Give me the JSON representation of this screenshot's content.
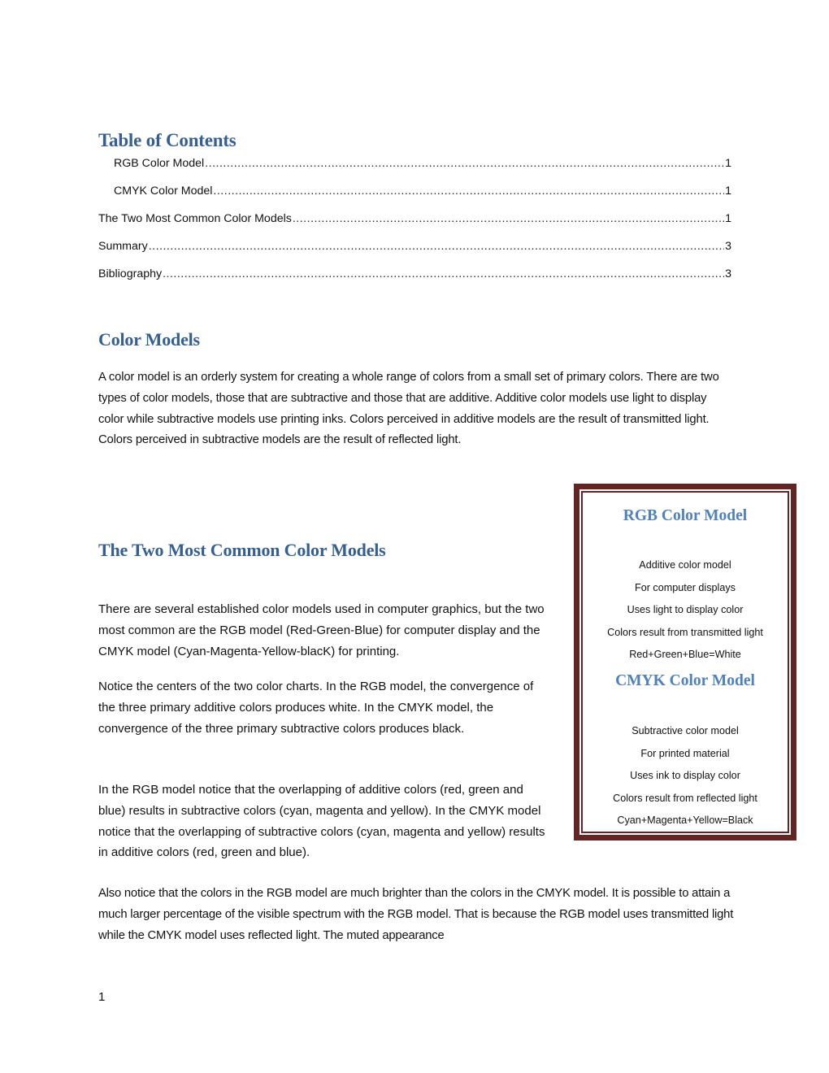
{
  "toc": {
    "title": "Table of Contents",
    "entries": [
      {
        "label": "RGB Color Model",
        "page": "1",
        "level": 2
      },
      {
        "label": "CMYK Color Model",
        "page": "1",
        "level": 2
      },
      {
        "label": "The Two Most Common Color Models",
        "page": "1",
        "level": 1
      },
      {
        "label": "Summary",
        "page": "3",
        "level": 1
      },
      {
        "label": "Bibliography",
        "page": "3",
        "level": 1
      }
    ]
  },
  "color_models": {
    "heading": "Color Models",
    "paragraph": "A color model is an orderly system for creating a whole range of colors from a small set of primary colors. There are two types of color models, those that are subtractive and those that are additive. Additive color models use light to display color while subtractive models use printing inks. Colors perceived in additive models are the result of transmitted light. Colors perceived in subtractive models are the result of reflected light."
  },
  "two_models": {
    "heading": "The Two Most Common Color Models",
    "paragraphs": [
      "There are several established color models used in computer graphics, but the two most common are the RGB model (Red-Green-Blue) for computer display and the CMYK model (Cyan-Magenta-Yellow-blacK) for printing.",
      "Notice the centers of the two color charts. In the RGB model, the convergence of the three primary additive colors produces white. In the CMYK model, the convergence of the three primary subtractive colors produces black.",
      "In the RGB model notice that the overlapping of additive colors (red, green and blue) results in subtractive colors (cyan, magenta and yellow). In the CMYK model notice that the overlapping of subtractive colors (cyan, magenta and yellow) results in additive colors (red, green and blue).",
      "Also notice that the colors in the RGB model are much brighter than the colors in the CMYK model. It is possible to attain a much larger percentage of the visible spectrum with the RGB model. That is because the RGB model uses transmitted light while the CMYK model uses reflected light. The muted appearance"
    ]
  },
  "sidebar": {
    "rgb": {
      "title": "RGB Color Model",
      "items": [
        "Additive color model",
        "For computer displays",
        "Uses light to display color",
        "Colors result from transmitted light",
        "Red+Green+Blue=White"
      ]
    },
    "cmyk": {
      "title": "CMYK Color Model",
      "items": [
        "Subtractive color model",
        "For printed material",
        "Uses ink to display color",
        "Colors result from reflected light",
        "Cyan+Magenta+Yellow=Black"
      ]
    },
    "border_color": "#632523",
    "title_color": "#4f81bd"
  },
  "colors": {
    "heading": "#365f91",
    "text": "#111111"
  },
  "footer": {
    "page_number": "1"
  }
}
